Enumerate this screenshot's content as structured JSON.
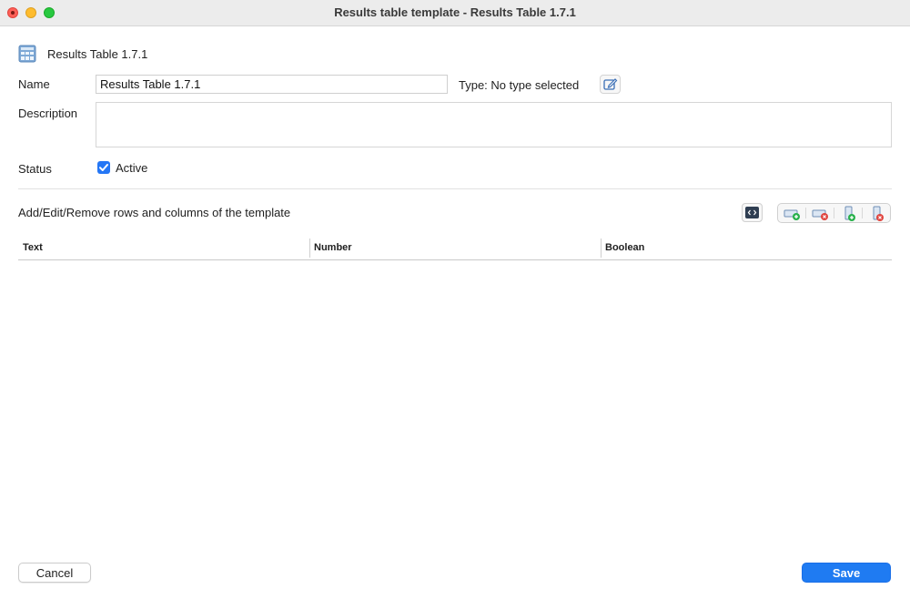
{
  "window": {
    "title": "Results table template - Results Table 1.7.1"
  },
  "header": {
    "icon": "calculator-table-icon",
    "name": "Results Table 1.7.1"
  },
  "form": {
    "name_label": "Name",
    "name_value": "Results Table 1.7.1",
    "type_label": "Type: No type selected",
    "description_label": "Description",
    "description_value": "",
    "status_label": "Status",
    "active_label": "Active",
    "active_checked": true
  },
  "template": {
    "section_label": "Add/Edit/Remove rows and columns of the template",
    "toolbar_icons": [
      "code-icon",
      "add-row-icon",
      "remove-row-icon",
      "add-column-icon",
      "remove-column-icon"
    ],
    "columns": [
      "Text",
      "Number",
      "Boolean"
    ],
    "rows": []
  },
  "footer": {
    "cancel_label": "Cancel",
    "save_label": "Save"
  },
  "colors": {
    "accent": "#1f7bf2",
    "add_green": "#28b14c",
    "remove_red": "#e0443e"
  }
}
